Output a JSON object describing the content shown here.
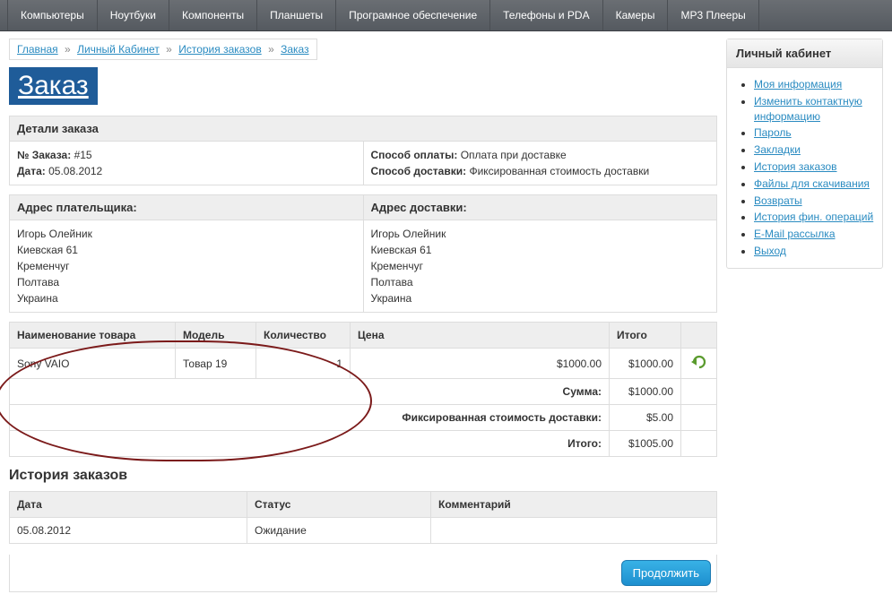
{
  "topnav": [
    "Компьютеры",
    "Ноутбуки",
    "Компоненты",
    "Планшеты",
    "Програмное обеспечение",
    "Телефоны и PDA",
    "Камеры",
    "MP3 Плееры"
  ],
  "breadcrumb": {
    "items": [
      "Главная",
      "Личный Кабинет",
      "История заказов",
      "Заказ"
    ],
    "sep": "»"
  },
  "page_title": "Заказ",
  "details": {
    "header": "Детали заказа",
    "order_no_label": "№ Заказа:",
    "order_no_value": "#15",
    "date_label": "Дата:",
    "date_value": "05.08.2012",
    "pay_method_label": "Способ оплаты:",
    "pay_method_value": "Оплата при доставке",
    "ship_method_label": "Способ доставки:",
    "ship_method_value": "Фиксированная стоимость доставки"
  },
  "addresses": {
    "payer_header": "Адрес плательщика:",
    "ship_header": "Адрес доставки:",
    "payer_lines": [
      "Игорь Олейник",
      "Киевская 61",
      "Кременчуг",
      "Полтава",
      "Украина"
    ],
    "ship_lines": [
      "Игорь Олейник",
      "Киевская 61",
      "Кременчуг",
      "Полтава",
      "Украина"
    ]
  },
  "items_table": {
    "headers": {
      "name": "Наименование товара",
      "model": "Модель",
      "qty": "Количество",
      "price": "Цена",
      "total": "Итого"
    },
    "rows": [
      {
        "name": "Sony VAIO",
        "model": "Товар 19",
        "qty": "1",
        "price": "$1000.00",
        "total": "$1000.00"
      }
    ],
    "totals": [
      {
        "label": "Сумма:",
        "value": "$1000.00"
      },
      {
        "label": "Фиксированная стоимость доставки:",
        "value": "$5.00"
      },
      {
        "label": "Итого:",
        "value": "$1005.00"
      }
    ]
  },
  "history": {
    "title": "История заказов",
    "headers": {
      "date": "Дата",
      "status": "Статус",
      "comment": "Комментарий"
    },
    "rows": [
      {
        "date": "05.08.2012",
        "status": "Ожидание",
        "comment": ""
      }
    ]
  },
  "continue_label": "Продолжить",
  "sidebar_box": {
    "header": "Личный кабинет",
    "links": [
      "Моя информация",
      "Изменить контактную информацию",
      "Пароль",
      "Закладки",
      "История заказов",
      "Файлы для скачивания",
      "Возвраты",
      "История фин. операций",
      "E-Mail рассылка",
      "Выход"
    ]
  }
}
